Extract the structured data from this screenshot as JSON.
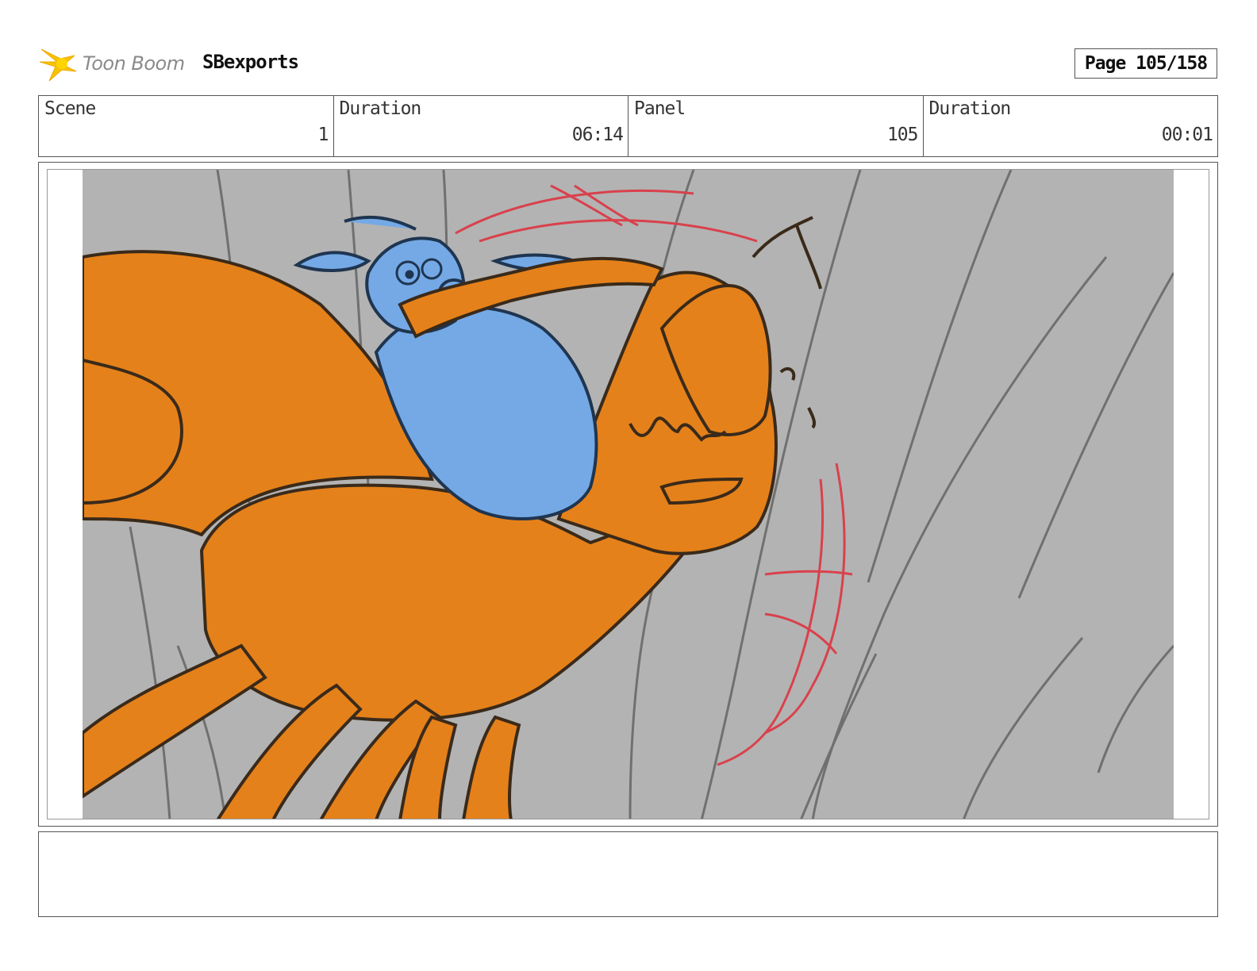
{
  "header": {
    "logo_text": "Toon Boom",
    "project_name": "SBexports",
    "page_label": "Page 105/158"
  },
  "info": {
    "scene_label": "Scene",
    "scene_value": "1",
    "scene_duration_label": "Duration",
    "scene_duration_value": "06:14",
    "panel_label": "Panel",
    "panel_value": "105",
    "panel_duration_label": "Duration",
    "panel_duration_value": "00:01"
  },
  "notes": {
    "text": ""
  },
  "colors": {
    "background_gray": "#b3b3b3",
    "character_orange": "#e5811a",
    "character_blue": "#74a9e6",
    "impact_red": "#d9414c",
    "ink": "#3a2a1a",
    "logo_yellow": "#f5c400"
  }
}
